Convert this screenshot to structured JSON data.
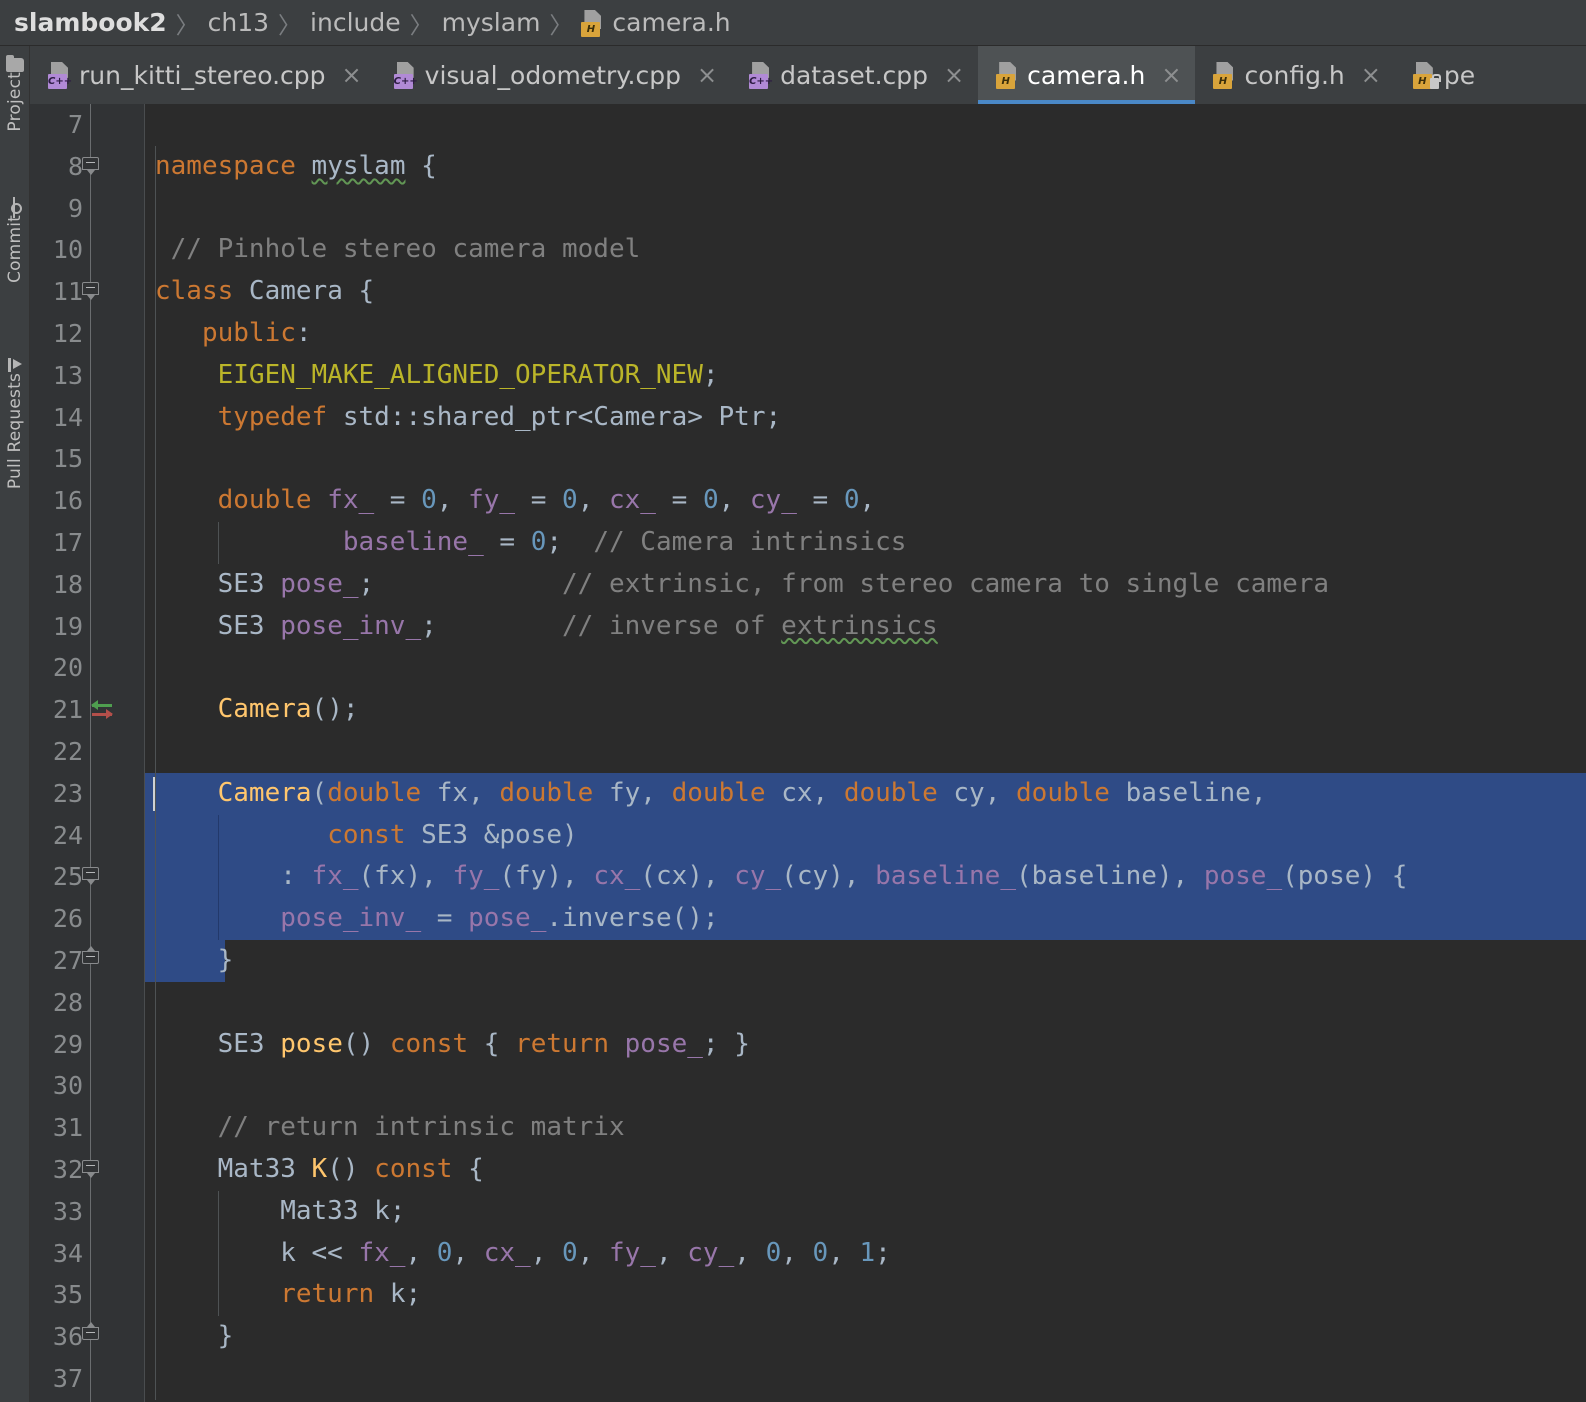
{
  "breadcrumb": {
    "items": [
      {
        "label": "slambook2",
        "icon": null,
        "root": true
      },
      {
        "label": "ch13",
        "icon": null
      },
      {
        "label": "include",
        "icon": null
      },
      {
        "label": "myslam",
        "icon": null
      },
      {
        "label": "camera.h",
        "icon": "header-file-icon"
      }
    ],
    "separator": "〉"
  },
  "sidebar": {
    "items": [
      {
        "label": "Project",
        "icon": "folder-icon"
      },
      {
        "label": "Commit",
        "icon": "commit-icon"
      },
      {
        "label": "Pull Requests",
        "icon": "pull-request-icon"
      }
    ]
  },
  "tabs": {
    "close_glyph": "×",
    "items": [
      {
        "label": "run_kitti_stereo.cpp",
        "icon": "cpp-file-icon",
        "badge": "C++",
        "active": false,
        "locked": false,
        "truncated": false
      },
      {
        "label": "visual_odometry.cpp",
        "icon": "cpp-file-icon",
        "badge": "C++",
        "active": false,
        "locked": false,
        "truncated": false
      },
      {
        "label": "dataset.cpp",
        "icon": "cpp-file-icon",
        "badge": "C++",
        "active": false,
        "locked": false,
        "truncated": false
      },
      {
        "label": "camera.h",
        "icon": "header-file-icon",
        "badge": "H",
        "active": true,
        "locked": false,
        "truncated": false
      },
      {
        "label": "config.h",
        "icon": "header-file-icon",
        "badge": "H",
        "active": false,
        "locked": false,
        "truncated": false
      },
      {
        "label": "pe",
        "icon": "header-file-locked-icon",
        "badge": "H",
        "active": false,
        "locked": true,
        "truncated": true
      }
    ]
  },
  "colors": {
    "editor_bg": "#2b2b2b",
    "gutter_bg": "#313335",
    "chrome_bg": "#3c3f41",
    "tab_active_bg": "#4e5254",
    "tab_active_underline": "#4a88c7",
    "selection_bg": "#2f4b86",
    "keyword": "#cc7832",
    "number": "#6897bb",
    "comment": "#808080",
    "macro": "#bbb529",
    "function": "#ffc66d",
    "field": "#9876aa",
    "default_text": "#a9b7c6",
    "line_number": "#888b8d",
    "squiggle": "#629755",
    "marker_implemented": "#4f9e4f",
    "marker_overrides": "#b34f4a"
  },
  "editor": {
    "first_line": 7,
    "lines": [
      {
        "n": 7,
        "selected": false,
        "fold": null,
        "marker": null,
        "tokens": []
      },
      {
        "n": 8,
        "selected": false,
        "fold": "start",
        "marker": null,
        "tokens": [
          {
            "t": "namespace ",
            "c": "kw"
          },
          {
            "t": "myslam",
            "c": "plain squig"
          },
          {
            "t": " {",
            "c": "plain"
          }
        ]
      },
      {
        "n": 9,
        "selected": false,
        "fold": null,
        "marker": null,
        "tokens": []
      },
      {
        "n": 10,
        "selected": false,
        "fold": null,
        "marker": null,
        "tokens": [
          {
            "t": " // Pinhole stereo camera model",
            "c": "cmt"
          }
        ]
      },
      {
        "n": 11,
        "selected": false,
        "fold": "start",
        "marker": null,
        "tokens": [
          {
            "t": "class ",
            "c": "kw"
          },
          {
            "t": "Camera",
            "c": "plain"
          },
          {
            "t": " {",
            "c": "plain"
          }
        ]
      },
      {
        "n": 12,
        "selected": false,
        "fold": null,
        "marker": null,
        "tokens": [
          {
            "t": "   public",
            "c": "kw"
          },
          {
            "t": ":",
            "c": "plain"
          }
        ]
      },
      {
        "n": 13,
        "selected": false,
        "fold": null,
        "marker": null,
        "tokens": [
          {
            "t": "    EIGEN_MAKE_ALIGNED_OPERATOR_NEW",
            "c": "macro"
          },
          {
            "t": ";",
            "c": "plain"
          }
        ]
      },
      {
        "n": 14,
        "selected": false,
        "fold": null,
        "marker": null,
        "tokens": [
          {
            "t": "    typedef ",
            "c": "kw"
          },
          {
            "t": "std::shared_ptr<Camera> Ptr;",
            "c": "plain"
          }
        ]
      },
      {
        "n": 15,
        "selected": false,
        "fold": null,
        "marker": null,
        "tokens": []
      },
      {
        "n": 16,
        "selected": false,
        "fold": null,
        "marker": null,
        "tokens": [
          {
            "t": "    double ",
            "c": "kw"
          },
          {
            "t": "fx_",
            "c": "field"
          },
          {
            "t": " = ",
            "c": "plain"
          },
          {
            "t": "0",
            "c": "num"
          },
          {
            "t": ", ",
            "c": "plain"
          },
          {
            "t": "fy_",
            "c": "field"
          },
          {
            "t": " = ",
            "c": "plain"
          },
          {
            "t": "0",
            "c": "num"
          },
          {
            "t": ", ",
            "c": "plain"
          },
          {
            "t": "cx_",
            "c": "field"
          },
          {
            "t": " = ",
            "c": "plain"
          },
          {
            "t": "0",
            "c": "num"
          },
          {
            "t": ", ",
            "c": "plain"
          },
          {
            "t": "cy_",
            "c": "field"
          },
          {
            "t": " = ",
            "c": "plain"
          },
          {
            "t": "0",
            "c": "num"
          },
          {
            "t": ",",
            "c": "plain"
          }
        ]
      },
      {
        "n": 17,
        "selected": false,
        "fold": null,
        "marker": null,
        "tokens": [
          {
            "t": "            ",
            "c": "plain"
          },
          {
            "t": "baseline_",
            "c": "field"
          },
          {
            "t": " = ",
            "c": "plain"
          },
          {
            "t": "0",
            "c": "num"
          },
          {
            "t": ";  ",
            "c": "plain"
          },
          {
            "t": "// Camera intrinsics",
            "c": "cmt"
          }
        ]
      },
      {
        "n": 18,
        "selected": false,
        "fold": null,
        "marker": null,
        "tokens": [
          {
            "t": "    SE3 ",
            "c": "type"
          },
          {
            "t": "pose_",
            "c": "field"
          },
          {
            "t": ";            ",
            "c": "plain"
          },
          {
            "t": "// extrinsic, from stereo camera to single camera",
            "c": "cmt"
          }
        ]
      },
      {
        "n": 19,
        "selected": false,
        "fold": null,
        "marker": null,
        "tokens": [
          {
            "t": "    SE3 ",
            "c": "type"
          },
          {
            "t": "pose_inv_",
            "c": "field"
          },
          {
            "t": ";        ",
            "c": "plain"
          },
          {
            "t": "// inverse of ",
            "c": "cmt"
          },
          {
            "t": "extrinsics",
            "c": "cmt squig"
          }
        ]
      },
      {
        "n": 20,
        "selected": false,
        "fold": null,
        "marker": null,
        "tokens": []
      },
      {
        "n": 21,
        "selected": false,
        "fold": null,
        "marker": "override-implement",
        "tokens": [
          {
            "t": "    ",
            "c": "plain"
          },
          {
            "t": "Camera",
            "c": "fn"
          },
          {
            "t": "();",
            "c": "plain"
          }
        ]
      },
      {
        "n": 22,
        "selected": false,
        "fold": null,
        "marker": null,
        "tokens": []
      },
      {
        "n": 23,
        "selected": true,
        "fold": null,
        "marker": null,
        "caret": true,
        "tokens": [
          {
            "t": "    ",
            "c": "plain"
          },
          {
            "t": "Camera",
            "c": "fn"
          },
          {
            "t": "(",
            "c": "plain"
          },
          {
            "t": "double ",
            "c": "kw"
          },
          {
            "t": "fx, ",
            "c": "param"
          },
          {
            "t": "double ",
            "c": "kw"
          },
          {
            "t": "fy, ",
            "c": "param"
          },
          {
            "t": "double ",
            "c": "kw"
          },
          {
            "t": "cx, ",
            "c": "param"
          },
          {
            "t": "double ",
            "c": "kw"
          },
          {
            "t": "cy, ",
            "c": "param"
          },
          {
            "t": "double ",
            "c": "kw"
          },
          {
            "t": "baseline,",
            "c": "param"
          }
        ]
      },
      {
        "n": 24,
        "selected": true,
        "fold": null,
        "marker": null,
        "tokens": [
          {
            "t": "           ",
            "c": "plain"
          },
          {
            "t": "const ",
            "c": "kw"
          },
          {
            "t": "SE3 &pose)",
            "c": "param"
          }
        ]
      },
      {
        "n": 25,
        "selected": true,
        "fold": "start",
        "marker": null,
        "tokens": [
          {
            "t": "        : ",
            "c": "plain"
          },
          {
            "t": "fx_",
            "c": "field"
          },
          {
            "t": "(fx), ",
            "c": "plain"
          },
          {
            "t": "fy_",
            "c": "field"
          },
          {
            "t": "(fy), ",
            "c": "plain"
          },
          {
            "t": "cx_",
            "c": "field"
          },
          {
            "t": "(cx), ",
            "c": "plain"
          },
          {
            "t": "cy_",
            "c": "field"
          },
          {
            "t": "(cy), ",
            "c": "plain"
          },
          {
            "t": "baseline_",
            "c": "field"
          },
          {
            "t": "(baseline), ",
            "c": "plain"
          },
          {
            "t": "pose_",
            "c": "field"
          },
          {
            "t": "(pose) {",
            "c": "plain"
          }
        ]
      },
      {
        "n": 26,
        "selected": true,
        "fold": null,
        "marker": null,
        "tokens": [
          {
            "t": "        ",
            "c": "plain"
          },
          {
            "t": "pose_inv_",
            "c": "field"
          },
          {
            "t": " = ",
            "c": "plain"
          },
          {
            "t": "pose_",
            "c": "field"
          },
          {
            "t": ".inverse();",
            "c": "plain"
          }
        ]
      },
      {
        "n": 27,
        "selected": "partial",
        "fold": "end",
        "marker": null,
        "tokens": [
          {
            "t": "    }",
            "c": "plain"
          }
        ]
      },
      {
        "n": 28,
        "selected": false,
        "fold": null,
        "marker": null,
        "tokens": []
      },
      {
        "n": 29,
        "selected": false,
        "fold": null,
        "marker": null,
        "tokens": [
          {
            "t": "    SE3 ",
            "c": "type"
          },
          {
            "t": "pose",
            "c": "fn"
          },
          {
            "t": "() ",
            "c": "plain"
          },
          {
            "t": "const ",
            "c": "kw"
          },
          {
            "t": "{ ",
            "c": "plain"
          },
          {
            "t": "return ",
            "c": "kw"
          },
          {
            "t": "pose_",
            "c": "field"
          },
          {
            "t": "; }",
            "c": "plain"
          }
        ]
      },
      {
        "n": 30,
        "selected": false,
        "fold": null,
        "marker": null,
        "tokens": []
      },
      {
        "n": 31,
        "selected": false,
        "fold": null,
        "marker": null,
        "tokens": [
          {
            "t": "    // return intrinsic matrix",
            "c": "cmt"
          }
        ]
      },
      {
        "n": 32,
        "selected": false,
        "fold": "start",
        "marker": null,
        "tokens": [
          {
            "t": "    Mat33 ",
            "c": "type"
          },
          {
            "t": "K",
            "c": "fn"
          },
          {
            "t": "() ",
            "c": "plain"
          },
          {
            "t": "const ",
            "c": "kw"
          },
          {
            "t": "{",
            "c": "plain"
          }
        ]
      },
      {
        "n": 33,
        "selected": false,
        "fold": null,
        "marker": null,
        "tokens": [
          {
            "t": "        Mat33 k;",
            "c": "type"
          }
        ]
      },
      {
        "n": 34,
        "selected": false,
        "fold": null,
        "marker": null,
        "tokens": [
          {
            "t": "        k << ",
            "c": "plain"
          },
          {
            "t": "fx_",
            "c": "field"
          },
          {
            "t": ", ",
            "c": "plain"
          },
          {
            "t": "0",
            "c": "num"
          },
          {
            "t": ", ",
            "c": "plain"
          },
          {
            "t": "cx_",
            "c": "field"
          },
          {
            "t": ", ",
            "c": "plain"
          },
          {
            "t": "0",
            "c": "num"
          },
          {
            "t": ", ",
            "c": "plain"
          },
          {
            "t": "fy_",
            "c": "field"
          },
          {
            "t": ", ",
            "c": "plain"
          },
          {
            "t": "cy_",
            "c": "field"
          },
          {
            "t": ", ",
            "c": "plain"
          },
          {
            "t": "0",
            "c": "num"
          },
          {
            "t": ", ",
            "c": "plain"
          },
          {
            "t": "0",
            "c": "num"
          },
          {
            "t": ", ",
            "c": "plain"
          },
          {
            "t": "1",
            "c": "num"
          },
          {
            "t": ";",
            "c": "plain"
          }
        ]
      },
      {
        "n": 35,
        "selected": false,
        "fold": null,
        "marker": null,
        "tokens": [
          {
            "t": "        return ",
            "c": "kw"
          },
          {
            "t": "k;",
            "c": "plain"
          }
        ]
      },
      {
        "n": 36,
        "selected": false,
        "fold": "end",
        "marker": null,
        "tokens": [
          {
            "t": "    }",
            "c": "plain"
          }
        ]
      },
      {
        "n": 37,
        "selected": false,
        "fold": null,
        "marker": null,
        "tokens": []
      }
    ]
  }
}
